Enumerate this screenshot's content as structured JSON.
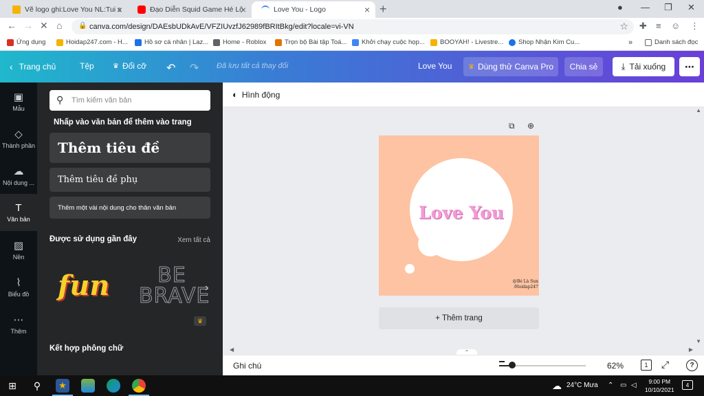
{
  "browser": {
    "tabs": [
      {
        "title": "Vẽ logo ghi:Love You NL:Tui sẽ mở",
        "color": "#f4b400"
      },
      {
        "title": "Đạo Diễn Squid Game Hé Lộ",
        "color": "#ff0000"
      },
      {
        "title": "Love You - Logo",
        "color": "#4285f4"
      }
    ],
    "url": "canva.com/design/DAEsbUDkAvE/VFZIUvzfJ62989fBRItBkg/edit?locale=vi-VN",
    "bookmarks": [
      {
        "label": "Ứng dụng",
        "color": "#d93025"
      },
      {
        "label": "Hoidap247.com - H...",
        "color": "#f4b400"
      },
      {
        "label": "Hồ sơ cá nhân | Laz...",
        "color": "#1a73e8"
      },
      {
        "label": "Home - Roblox",
        "color": "#5f6368"
      },
      {
        "label": "Trọn bộ Bài tập Toá...",
        "color": "#e37400"
      },
      {
        "label": "Khởi chạy cuộc họp...",
        "color": "#4285f4"
      },
      {
        "label": "BOOYAH! - Livestre...",
        "color": "#f4b400"
      },
      {
        "label": "Shop Nhận Kim Cu...",
        "color": "#1a73e8"
      }
    ],
    "bookmark_overflow": "»",
    "reading_list": "Danh sách đọc"
  },
  "canva": {
    "header": {
      "home": "Trang chủ",
      "file": "Tệp",
      "resize": "Đổi cỡ",
      "saved": "Đã lưu tất cả thay đổi",
      "doc_title": "Love You",
      "try_pro": "Dùng thử Canva Pro",
      "share": "Chia sẻ",
      "download": "Tải xuống"
    },
    "rail": [
      {
        "label": "Mẫu",
        "icon": "template-icon",
        "glyph": "▣"
      },
      {
        "label": "Thành phần",
        "icon": "elements-icon",
        "glyph": "◇"
      },
      {
        "label": "Nội dung ...",
        "icon": "uploads-icon",
        "glyph": "☁"
      },
      {
        "label": "Văn bản",
        "icon": "text-icon",
        "glyph": "T"
      },
      {
        "label": "Nền",
        "icon": "background-icon",
        "glyph": "▨"
      },
      {
        "label": "Biểu đồ",
        "icon": "chart-icon",
        "glyph": "⌇"
      },
      {
        "label": "Thêm",
        "icon": "more-icon",
        "glyph": "⋯"
      }
    ],
    "panel": {
      "search_placeholder": "Tìm kiếm văn bản",
      "hint": "Nhấp vào văn bản để thêm vào trang",
      "heading": "Thêm tiêu đề",
      "subheading": "Thêm tiêu đề phụ",
      "body": "Thêm một vài nội dung cho thân văn bản",
      "recent": "Được sử dụng gần đây",
      "see_all": "Xem tất cả",
      "sample_fun": "fun",
      "sample_brave": "BE BRAVE",
      "font_combos": "Kết hợp phông chữ"
    },
    "toolbar": {
      "animate": "Hình động"
    },
    "design": {
      "text": "Love You",
      "watermark_line1": "@Bé Là Sun",
      "watermark_line2": "/Hoidap247",
      "bg_color": "#fdc3a2",
      "text_color": "#f49ad4"
    },
    "add_page": "+ Thêm trang",
    "bottom": {
      "notes": "Ghi chú",
      "zoom": "62%",
      "zoom_level": 0.62,
      "page": "1"
    }
  },
  "taskbar": {
    "weather": "24°C  Mưa",
    "time": "9:00 PM",
    "date": "10/10/2021",
    "notifications": "4"
  }
}
